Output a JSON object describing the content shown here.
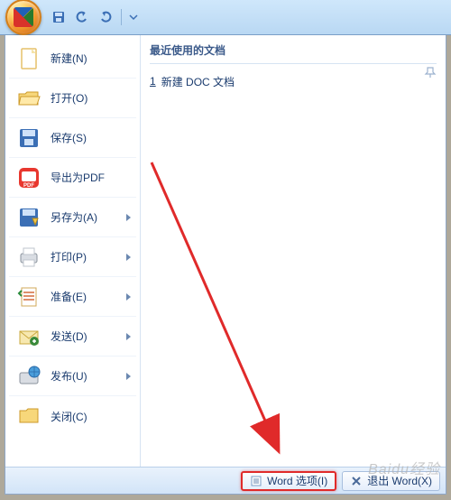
{
  "titlebar": {
    "qat_save": "save",
    "qat_undo": "undo",
    "qat_redo": "redo"
  },
  "menu": {
    "items": [
      {
        "label": "新建(N)",
        "icon": "new",
        "submenu": false
      },
      {
        "label": "打开(O)",
        "icon": "open",
        "submenu": false
      },
      {
        "label": "保存(S)",
        "icon": "save",
        "submenu": false
      },
      {
        "label": "导出为PDF",
        "icon": "pdf",
        "submenu": false
      },
      {
        "label": "另存为(A)",
        "icon": "saveas",
        "submenu": true
      },
      {
        "label": "打印(P)",
        "icon": "print",
        "submenu": true
      },
      {
        "label": "准备(E)",
        "icon": "prepare",
        "submenu": true
      },
      {
        "label": "发送(D)",
        "icon": "send",
        "submenu": true
      },
      {
        "label": "发布(U)",
        "icon": "publish",
        "submenu": true
      },
      {
        "label": "关闭(C)",
        "icon": "close",
        "submenu": false
      }
    ]
  },
  "recent": {
    "title": "最近使用的文档",
    "items": [
      {
        "num": "1",
        "label": "新建 DOC 文档"
      }
    ]
  },
  "footer": {
    "options_label": "Word 选项(I)",
    "exit_label": "退出 Word(X)"
  },
  "watermark": "Baidu经验"
}
